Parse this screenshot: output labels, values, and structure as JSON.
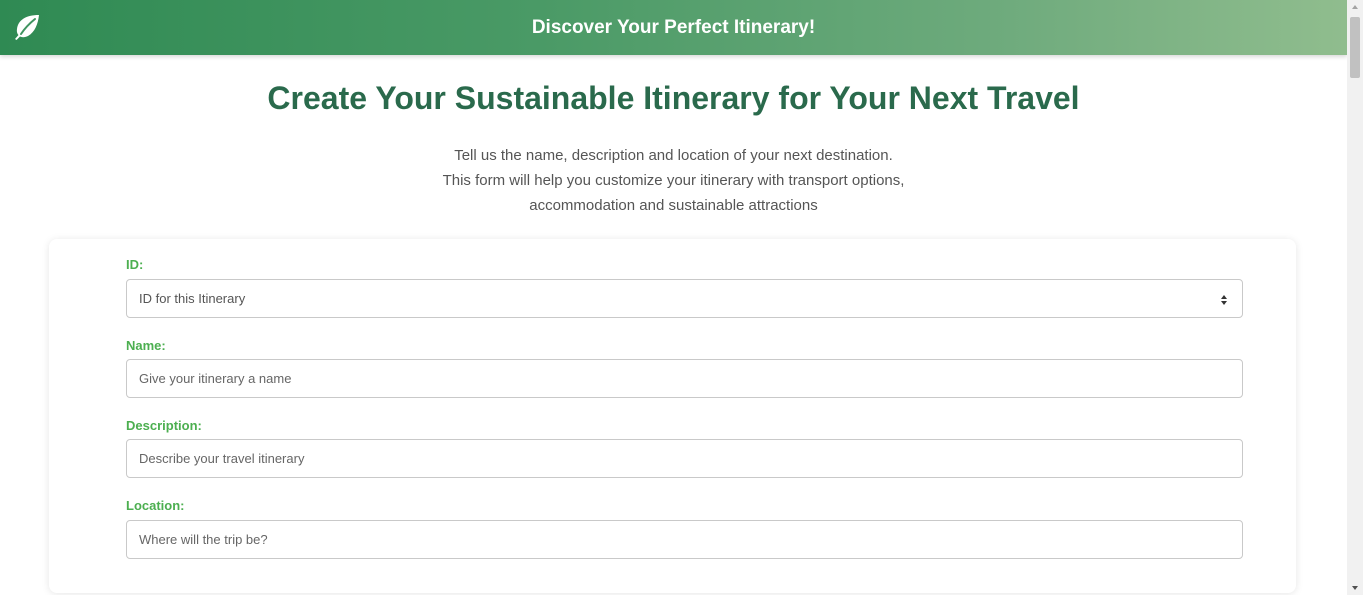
{
  "header": {
    "title": "Discover Your Perfect Itinerary!",
    "logo_icon": "leaf-icon",
    "gradient_colors": [
      "#2f8a53",
      "#90bd8e"
    ]
  },
  "page": {
    "title": "Create Your Sustainable Itinerary for Your Next Travel",
    "intro_lines": [
      "Tell us the name, description and location of your next destination.",
      "This form will help you customize your itinerary with transport options,",
      "accommodation and sustainable attractions"
    ]
  },
  "form": {
    "id": {
      "label": "ID:",
      "placeholder": "ID for this Itinerary"
    },
    "name": {
      "label": "Name:",
      "placeholder": "Give your itinerary a name"
    },
    "description": {
      "label": "Description:",
      "placeholder": "Describe your travel itinerary"
    },
    "location": {
      "label": "Location:",
      "placeholder": "Where will the trip be?"
    }
  },
  "colors": {
    "title": "#2a6a4c",
    "label": "#4caf50",
    "text": "#555555"
  }
}
